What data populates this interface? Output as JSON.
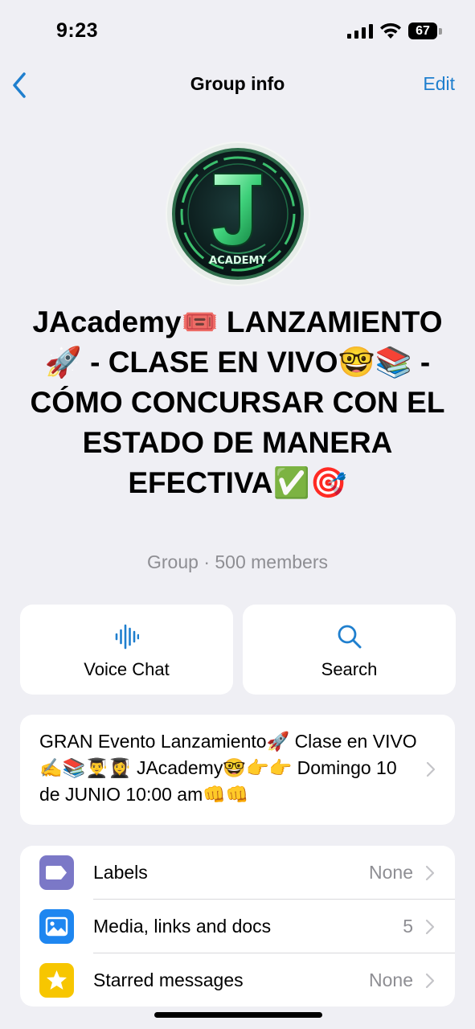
{
  "status_bar": {
    "time": "9:23",
    "battery": "67"
  },
  "nav": {
    "title": "Group info",
    "edit_label": "Edit"
  },
  "group": {
    "name": "JAcademy🎟️ LANZAMIENTO🚀 - CLASE EN VIVO🤓📚 - CÓMO CONCURSAR CON EL ESTADO DE MANERA EFECTIVA✅🎯",
    "subtitle": "Group · 500 members",
    "avatar_text": "ACADEMY"
  },
  "actions": [
    {
      "label": "Voice Chat",
      "icon": "voice-chat-icon"
    },
    {
      "label": "Search",
      "icon": "search-icon"
    }
  ],
  "description": "GRAN Evento Lanzamiento🚀 Clase en VIVO ✍️📚👨‍🎓👩‍🎓 JAcademy🤓👉👉 Domingo 10 de JUNIO 10:00 am👊👊",
  "list": [
    {
      "label": "Labels",
      "value": "None",
      "icon": "label-icon",
      "color": "#7b78c7"
    },
    {
      "label": "Media, links and docs",
      "value": "5",
      "icon": "photo-icon",
      "color": "#1e86f0"
    },
    {
      "label": "Starred messages",
      "value": "None",
      "icon": "star-icon",
      "color": "#f7c600"
    }
  ],
  "colors": {
    "accent": "#1f7fce",
    "background": "#efeff4"
  }
}
